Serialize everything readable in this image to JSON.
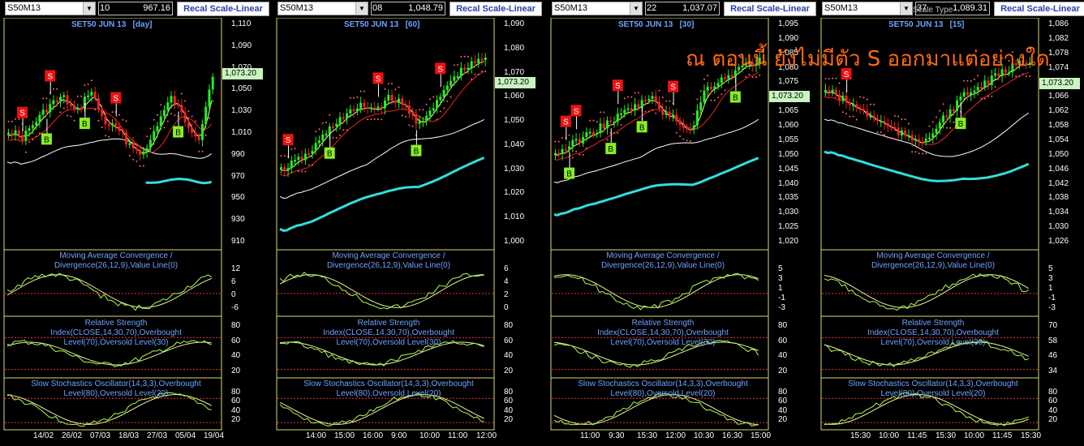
{
  "colors": {
    "bull": "#22ee22",
    "bear": "#ee2222",
    "ma1": "#ffff99",
    "ma2": "#ee2222",
    "ma3": "#ffffff",
    "ma4": "#33dddd",
    "sar": "#ff6666",
    "label": "#6fa0ff",
    "orange": "#ff6a10"
  },
  "overlay_text": "ณ ตอนนี้ ยังไม่มีตัว S ออกมาแต่อย่างใด",
  "scale_type_label": "Scale Type",
  "panels": [
    {
      "symbol": "S50M13",
      "mid_left": "10",
      "mid_right": "967.16",
      "recal": "Recal Scale-Linear",
      "title": "SET50 JUN 13   [day]",
      "price_tag": "1,073.20",
      "price_axis": [
        "1,110",
        "1,090",
        "1,070",
        "1,050",
        "1,030",
        "1,010",
        "990",
        "970",
        "950",
        "930",
        "910"
      ],
      "macd_title": "Moving Average Convergence / Divergence(26,12,9),Value Line(0)",
      "macd_axis": [
        "12",
        "6",
        "0",
        "-6"
      ],
      "rsi_title": "Relative Strength Index(CLOSE,14,30,70),Overbought Level(70),Oversold Level(30)",
      "rsi_axis": [
        "80",
        "60",
        "40",
        "20"
      ],
      "sto_title": "Slow Stochastics Oscillator(14,3,3),Overbought Level(80),Oversold Level(20)",
      "sto_axis": [
        "80",
        "60",
        "40",
        "20"
      ],
      "time_axis": [
        "14/02",
        "26/02",
        "07/03",
        "18/03",
        "27/03",
        "05/04",
        "19/04"
      ]
    },
    {
      "symbol": "S50M13",
      "mid_left": "08",
      "mid_right": "1,048.79",
      "recal": "Recal Scale-Linear",
      "title": "SET50 JUN 13   [60]",
      "price_tag": "1,073.20",
      "price_axis": [
        "1,090",
        "1,080",
        "1,070",
        "1,060",
        "1,050",
        "1,040",
        "1,030",
        "1,020",
        "1,010",
        "1,000"
      ],
      "macd_title": "Moving Average Convergence / Divergence(26,12,9),Value Line(0)",
      "macd_axis": [
        "6",
        "4",
        "2",
        "0"
      ],
      "rsi_title": "Relative Strength Index(CLOSE,14,30,70),Overbought Level(70),Oversold Level(30)",
      "rsi_axis": [
        "80",
        "60",
        "40",
        "20"
      ],
      "sto_title": "Slow Stochastics Oscillator(14,3,3),Overbought Level(80),Oversold Level(20)",
      "sto_axis": [
        "80",
        "60",
        "40",
        "20"
      ],
      "time_axis": [
        "14:00",
        "15:00",
        "16:00",
        "9:00",
        "10:00",
        "11:00",
        "12:00"
      ]
    },
    {
      "symbol": "S50M13",
      "mid_left": "22",
      "mid_right": "1,037.07",
      "recal": "Recal Scale-Linear",
      "title": "SET50 JUN 13   [30]",
      "price_tag": "1,073.20",
      "price_axis": [
        "1,095",
        "1,090",
        "1,085",
        "1,080",
        "1,075",
        "1,070",
        "1,065",
        "1,060",
        "1,055",
        "1,050",
        "1,045",
        "1,040",
        "1,035",
        "1,030",
        "1,025",
        "1,020"
      ],
      "macd_title": "Moving Average Convergence / Divergence(26,12,9),Value Line(0)",
      "macd_axis": [
        "5",
        "3",
        "1",
        "-1",
        "-3"
      ],
      "rsi_title": "Relative Strength Index(CLOSE,14,30,70),Overbought Level(70),Oversold Level(30)",
      "rsi_axis": [
        "80",
        "60",
        "40",
        "20"
      ],
      "sto_title": "Slow Stochastics Oscillator(14,3,3),Overbought Level(80),Oversold Level(20)",
      "sto_axis": [
        "80",
        "60",
        "40",
        "20"
      ],
      "time_axis": [
        "11:00",
        "9:30",
        "15:30",
        "12:00",
        "10:30",
        "16:30",
        "15:00"
      ]
    },
    {
      "symbol": "S50M13",
      "mid_left": "37",
      "mid_right": "1,089.31",
      "recal": "Recal Scale-Linear",
      "title": "SET50 JUN 13   [15]",
      "price_tag": "1,073.20",
      "price_axis": [
        "1,086",
        "1,082",
        "1,078",
        "1,074",
        "1,070",
        "1,066",
        "1,062",
        "1,058",
        "1,054",
        "1,050",
        "1,046",
        "1,042",
        "1,038",
        "1,034",
        "1,030",
        "1,026"
      ],
      "macd_title": "Moving Average Convergence / Divergence(26,12,9),Value Line(0)",
      "macd_axis": [
        "5",
        "3",
        "1",
        "-1",
        "-3"
      ],
      "rsi_title": "Relative Strength Index(CLOSE,14,30,70),Overbought Level(70),Oversold Level(30)",
      "rsi_axis": [
        "70",
        "58",
        "46",
        "34"
      ],
      "sto_title": "Slow Stochastics Oscillator(14,3,3),Overbought Level(80),Oversold Level(20)",
      "sto_axis": [
        "80",
        "60",
        "40",
        "20"
      ],
      "time_axis": [
        "15:30",
        "10:00",
        "11:45",
        "15:30",
        "10:00",
        "11:45",
        "15:30"
      ]
    }
  ]
}
